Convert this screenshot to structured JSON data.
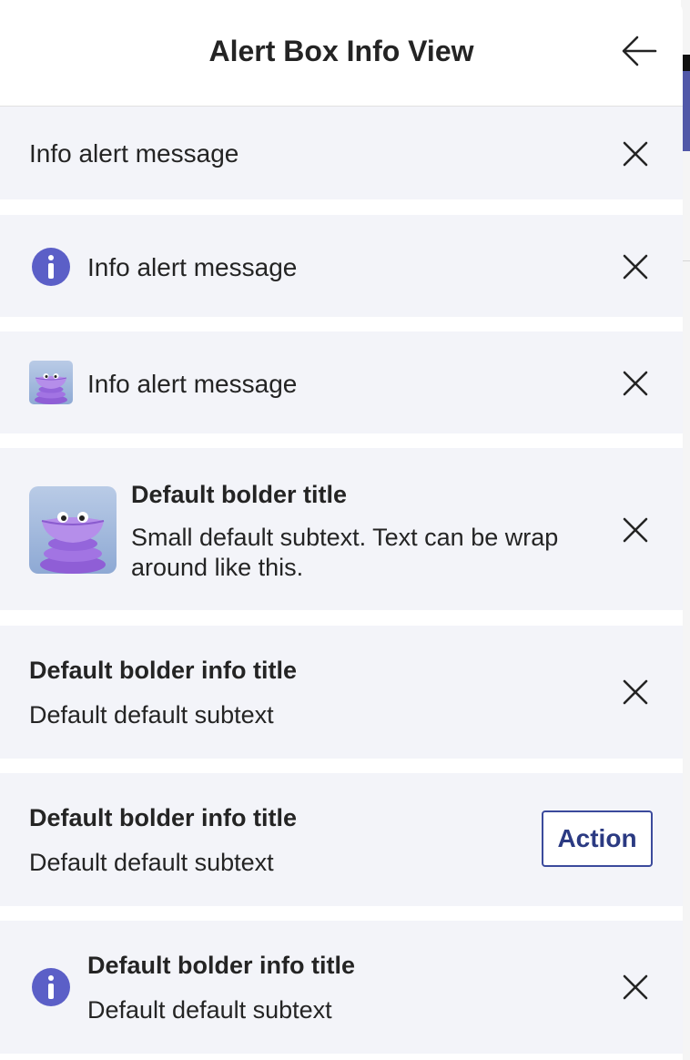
{
  "header": {
    "title": "Alert Box Info View",
    "back_icon": "arrow-left-icon"
  },
  "alerts": [
    {
      "message": "Info alert message",
      "dismiss_icon": "close-icon"
    },
    {
      "icon": "info-icon",
      "message": "Info alert message",
      "dismiss_icon": "close-icon"
    },
    {
      "icon": "avatar-image",
      "message": "Info alert message",
      "dismiss_icon": "close-icon"
    },
    {
      "icon": "avatar-image",
      "title": "Default bolder title",
      "subtext": "Small default subtext. Text can be wrap around like this.",
      "dismiss_icon": "close-icon"
    },
    {
      "title": "Default bolder info title",
      "subtext": "Default default subtext",
      "dismiss_icon": "close-icon"
    },
    {
      "title": "Default bolder info title",
      "subtext": "Default default subtext",
      "action_label": "Action"
    },
    {
      "icon": "info-icon",
      "title": "Default bolder info title",
      "subtext": "Default default subtext",
      "dismiss_icon": "close-icon"
    }
  ],
  "colors": {
    "alert_background": "#f3f4f9",
    "info_icon": "#5b5fc7",
    "action_border": "#3b4a9c",
    "text": "#242424"
  }
}
